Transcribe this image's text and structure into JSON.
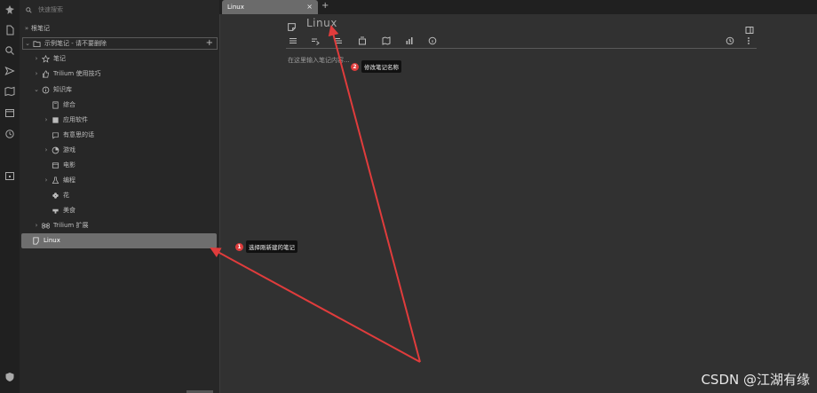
{
  "search": {
    "placeholder": "快速搜索"
  },
  "tree": {
    "items": [
      {
        "label": "根笔记",
        "arrow": "»",
        "level": 0
      },
      {
        "label": "示例笔记 - 请不要删除",
        "arrow": "⌄",
        "level": 0
      },
      {
        "label": "笔记",
        "arrow": "›",
        "level": 1
      },
      {
        "label": "Trilium 使用技巧",
        "arrow": "›",
        "level": 1
      },
      {
        "label": "知识库",
        "arrow": "⌄",
        "level": 1
      },
      {
        "label": "综合",
        "arrow": "",
        "level": 2
      },
      {
        "label": "应用软件",
        "arrow": "›",
        "level": 2
      },
      {
        "label": "有意思的话",
        "arrow": "",
        "level": 2
      },
      {
        "label": "游戏",
        "arrow": "›",
        "level": 2
      },
      {
        "label": "电影",
        "arrow": "",
        "level": 2
      },
      {
        "label": "编程",
        "arrow": "›",
        "level": 2
      },
      {
        "label": "花",
        "arrow": "",
        "level": 2
      },
      {
        "label": "美食",
        "arrow": "",
        "level": 2
      },
      {
        "label": "Trilium 扩展",
        "arrow": "›",
        "level": 1
      },
      {
        "label": "Linux",
        "arrow": "",
        "level": 0
      }
    ],
    "add_symbol": "+"
  },
  "tabs": [
    {
      "label": "Linux",
      "close": "×"
    }
  ],
  "tab_add": "+",
  "note": {
    "title": "Linux",
    "placeholder": "在这里输入笔记内容..."
  },
  "annotations": [
    {
      "number": "1",
      "text": "选择刚新建的笔记"
    },
    {
      "number": "2",
      "text": "修改笔记名称"
    }
  ],
  "watermark": "CSDN @江湖有缘",
  "colors": {
    "accent_red": "#e03c3c",
    "selected": "#6e6e6e"
  }
}
